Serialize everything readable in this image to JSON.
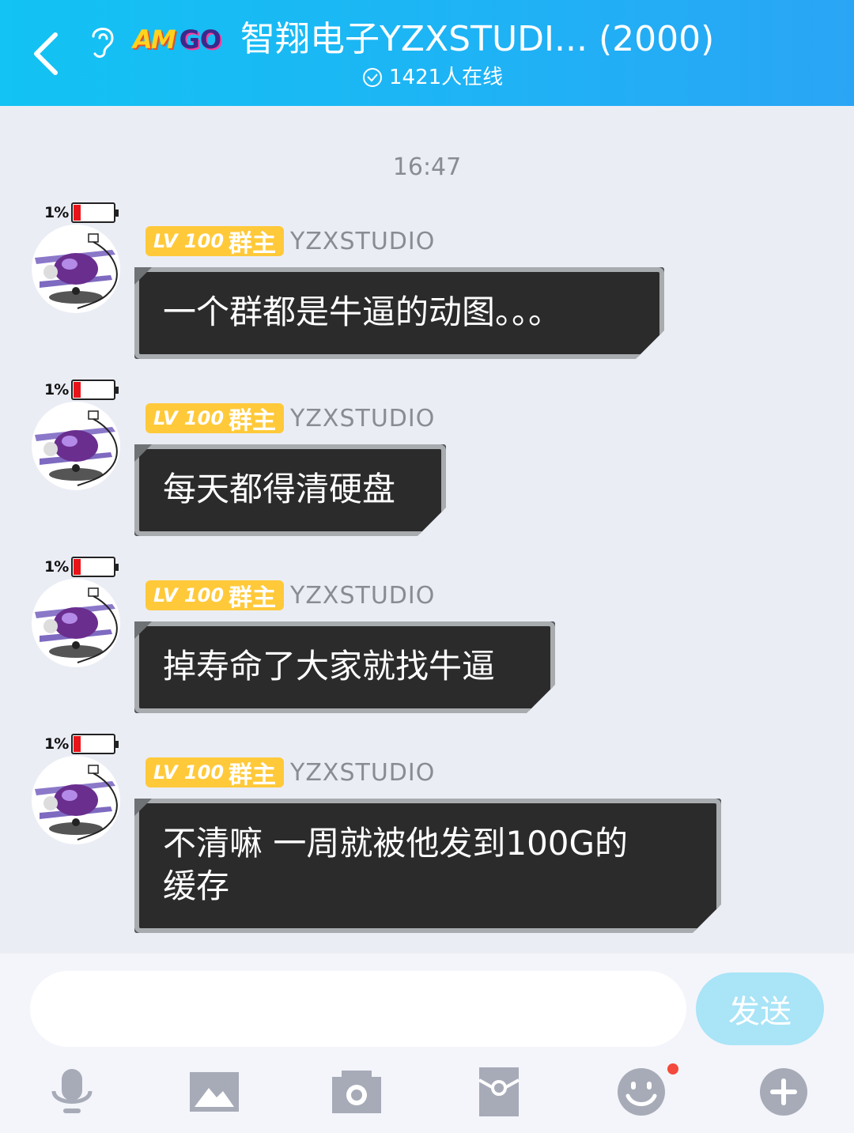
{
  "header": {
    "logo_text_1": "AM",
    "logo_text_2": "GO",
    "title": "智翔电子YZXSTUDI... (2000)",
    "online_count": "1421人在线"
  },
  "chat": {
    "timestamp": "16:47",
    "messages": [
      {
        "battery": "1%",
        "level": "LV 100",
        "role": "群主",
        "username": "YZXSTUDIO",
        "text": "一个群都是牛逼的动图。。。"
      },
      {
        "battery": "1%",
        "level": "LV 100",
        "role": "群主",
        "username": "YZXSTUDIO",
        "text": "每天都得清硬盘"
      },
      {
        "battery": "1%",
        "level": "LV 100",
        "role": "群主",
        "username": "YZXSTUDIO",
        "text": "掉寿命了大家就找牛逼"
      },
      {
        "battery": "1%",
        "level": "LV 100",
        "role": "群主",
        "username": "YZXSTUDIO",
        "text_line1": "不清嘛 一周就被他发到100G的",
        "text_line2": "缓存"
      }
    ]
  },
  "input": {
    "value": "",
    "send_label": "发送"
  },
  "toolbar": {
    "icons": [
      "microphone-icon",
      "image-icon",
      "camera-icon",
      "red-packet-icon",
      "emoji-icon",
      "plus-icon"
    ]
  },
  "colors": {
    "header_accent": "#1fb2f5",
    "level_badge": "#ffc93a",
    "send_button": "#a9e4f7",
    "notification_dot": "#f4493d"
  }
}
